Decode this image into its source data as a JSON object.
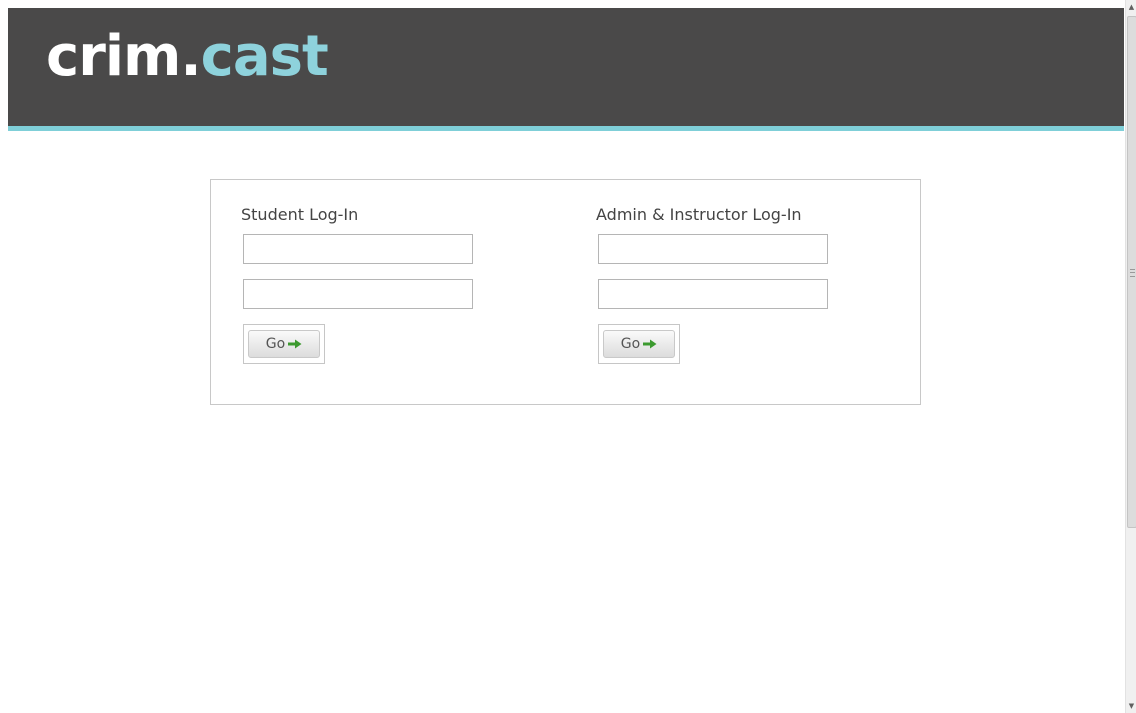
{
  "header": {
    "logo_part1": "crim.",
    "logo_part2": "cast",
    "colors": {
      "background": "#4a4949",
      "accent": "#7fcfd8",
      "logo_highlight": "#8ed2dc"
    }
  },
  "student_login": {
    "title": "Student Log-In",
    "username_value": "",
    "password_value": "",
    "go_label": "Go",
    "go_icon": "green-arrow-icon"
  },
  "admin_login": {
    "title": "Admin & Instructor Log-In",
    "username_value": "",
    "password_value": "",
    "go_label": "Go",
    "go_icon": "green-arrow-icon"
  },
  "scrollbar": {
    "up_icon": "scroll-up-arrow-icon",
    "down_icon": "scroll-down-arrow-icon",
    "up_glyph": "▲",
    "down_glyph": "▼"
  }
}
